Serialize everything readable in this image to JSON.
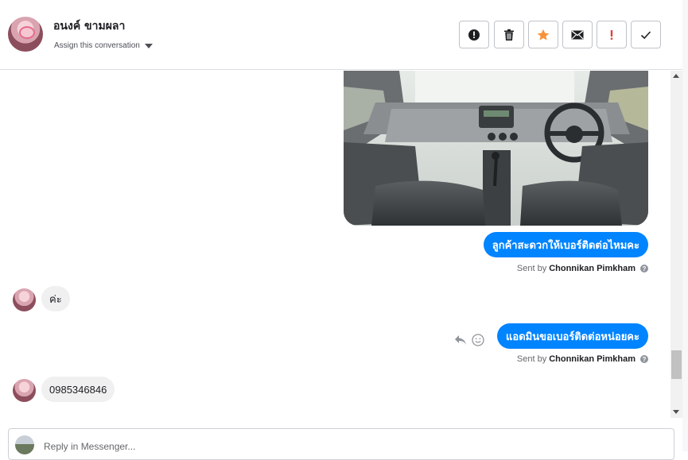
{
  "header": {
    "contact_name": "อนงค์ ขามผลา",
    "assign_label": "Assign this conversation"
  },
  "toolbar": {
    "buttons": [
      {
        "name": "spam-alert-icon",
        "label": "!"
      },
      {
        "name": "trash-icon",
        "label": ""
      },
      {
        "name": "star-icon",
        "label": ""
      },
      {
        "name": "mail-icon",
        "label": ""
      },
      {
        "name": "follow-up-icon",
        "label": "!"
      },
      {
        "name": "check-icon",
        "label": ""
      }
    ],
    "colors": {
      "star": "#f7923a",
      "follow_up": "#e0403e"
    }
  },
  "messages": [
    {
      "type": "image",
      "from": "page",
      "alt": "car interior photo"
    },
    {
      "type": "text",
      "from": "page",
      "text": "ลูกค้าสะดวกให้เบอร์ติดต่อไหมคะ"
    },
    {
      "type": "sent_by",
      "prefix": "Sent by",
      "name": "Chonnikan Pimkham",
      "help": "?"
    },
    {
      "type": "text",
      "from": "customer",
      "text": "ค่ะ"
    },
    {
      "type": "text",
      "from": "page",
      "text": "แอดมินขอเบอร์ติดต่อหน่อยคะ"
    },
    {
      "type": "sent_by",
      "prefix": "Sent by",
      "name": "Chonnikan Pimkham",
      "help": "?"
    },
    {
      "type": "text",
      "from": "customer",
      "text": "0985346846"
    }
  ],
  "composer": {
    "placeholder": "Reply in Messenger..."
  },
  "colors": {
    "accent": "#0084ff",
    "incoming_bubble": "#f1f0f0"
  }
}
